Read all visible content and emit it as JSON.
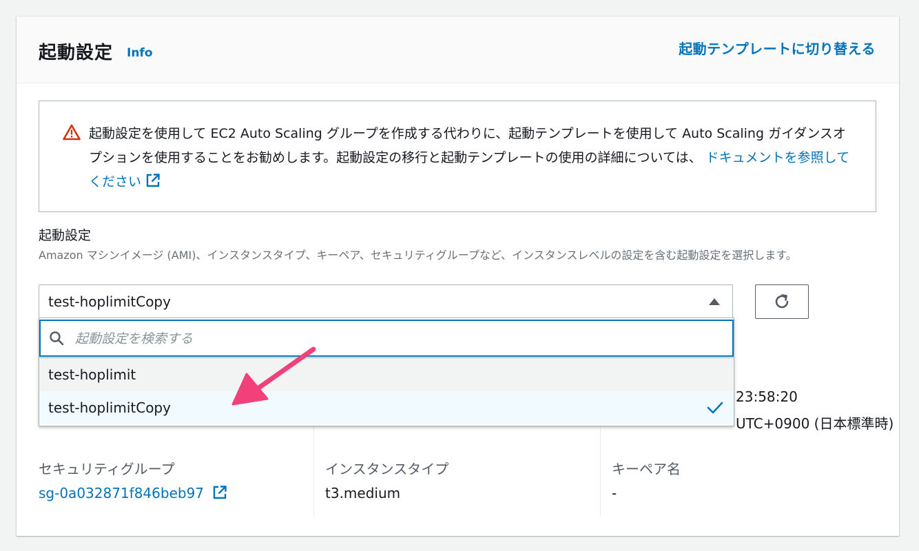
{
  "header": {
    "title": "起動設定",
    "info": "Info",
    "switch_link": "起動テンプレートに切り替える"
  },
  "alert": {
    "text": "起動設定を使用して EC2 Auto Scaling グループを作成する代わりに、起動テンプレートを使用して Auto Scaling ガイダンスオプションを使用することをお勧めします。起動設定の移行と起動テンプレートの使用の詳細については、",
    "link": "ドキュメントを参照してください"
  },
  "field": {
    "label": "起動設定",
    "description": "Amazon マシンイメージ (AMI)、インスタンスタイプ、キーペア、セキュリティグループなど、インスタンスレベルの設定を含む起動設定を選択します。",
    "selected_value": "test-hoplimitCopy"
  },
  "dropdown": {
    "search_placeholder": "起動設定を検索する",
    "options": [
      {
        "label": "test-hoplimit",
        "state": "hover"
      },
      {
        "label": "test-hoplimitCopy",
        "state": "selected"
      }
    ]
  },
  "details": {
    "created_time_partial": "23:58:20",
    "created_tz_partial": "UTC+0900 (日本標準時)",
    "security_group_label": "セキュリティグループ",
    "security_group_value": "sg-0a032871f846beb97",
    "instance_type_label": "インスタンスタイプ",
    "instance_type_value": "t3.medium",
    "key_pair_label": "キーペア名",
    "key_pair_value": "-"
  },
  "colors": {
    "link": "#0073bb",
    "warning": "#d13212",
    "annotation_arrow": "#f2407a"
  },
  "icons": [
    "warning-icon",
    "external-link-icon",
    "caret-up-icon",
    "refresh-icon",
    "search-icon",
    "check-icon"
  ]
}
